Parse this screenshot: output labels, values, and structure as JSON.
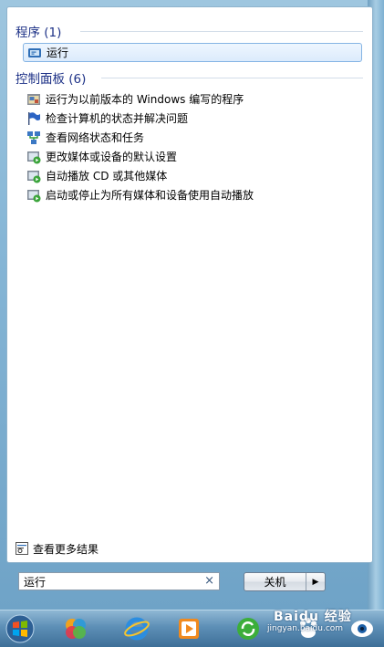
{
  "groups": {
    "programs": {
      "title": "程序 (1)",
      "items": [
        {
          "label": "运行",
          "icon": "run-icon"
        }
      ]
    },
    "control_panel": {
      "title": "控制面板 (6)",
      "items": [
        {
          "label": "运行为以前版本的 Windows 编写的程序",
          "icon": "compatibility-icon"
        },
        {
          "label": "检查计算机的状态并解决问题",
          "icon": "action-center-flag-icon"
        },
        {
          "label": "查看网络状态和任务",
          "icon": "network-icon"
        },
        {
          "label": "更改媒体或设备的默认设置",
          "icon": "autoplay-icon"
        },
        {
          "label": "自动播放 CD 或其他媒体",
          "icon": "autoplay-icon"
        },
        {
          "label": "启动或停止为所有媒体和设备使用自动播放",
          "icon": "autoplay-icon"
        }
      ]
    }
  },
  "see_more": "查看更多结果",
  "search": {
    "value": "运行",
    "clear": "×"
  },
  "power": {
    "label": "关机",
    "arrow": "▶"
  },
  "taskbar": [
    {
      "icon": "start-orb-icon"
    },
    {
      "icon": "colorful-app-icon"
    },
    {
      "icon": "internet-explorer-icon"
    },
    {
      "icon": "media-player-icon"
    },
    {
      "icon": "green-refresh-app-icon"
    },
    {
      "icon": "baidu-paw-icon"
    },
    {
      "icon": "eye-app-icon"
    }
  ],
  "watermark": {
    "text": "Baidu 经验",
    "url": "jingyan.baidu.com"
  }
}
